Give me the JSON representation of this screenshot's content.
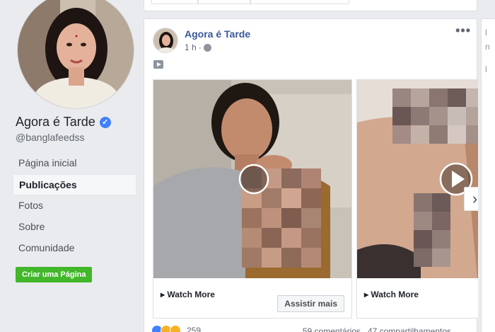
{
  "page": {
    "name": "Agora é Tarde",
    "handle": "@banglafeedss"
  },
  "nav": [
    {
      "label": "Página inicial",
      "active": false
    },
    {
      "label": "Publicações",
      "active": true
    },
    {
      "label": "Fotos",
      "active": false
    },
    {
      "label": "Sobre",
      "active": false
    },
    {
      "label": "Comunidade",
      "active": false
    }
  ],
  "create_page_button": "Criar uma Página",
  "post": {
    "author": "Agora é Tarde",
    "time": "1 h",
    "separator": "·",
    "more_icon": "•••",
    "slides": [
      {
        "watch_label": "▸ Watch More",
        "cta": "Assistir mais"
      },
      {
        "watch_label": "▸ Watch More"
      }
    ],
    "reaction_count": "259",
    "comments": "59 comentários",
    "shares": "47 compartilhamentos"
  },
  "right_card_letters": [
    "l",
    "n",
    "l"
  ],
  "colors": {
    "accent": "#385898",
    "verified": "#4080ff",
    "create_button": "#42b72a",
    "background": "#e9ebee"
  }
}
